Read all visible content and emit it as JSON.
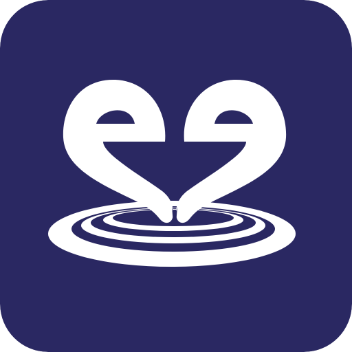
{
  "icon": {
    "name": "heart-ripple-logo",
    "colors": {
      "background": "#2a2862",
      "foreground": "#ffffff"
    }
  }
}
